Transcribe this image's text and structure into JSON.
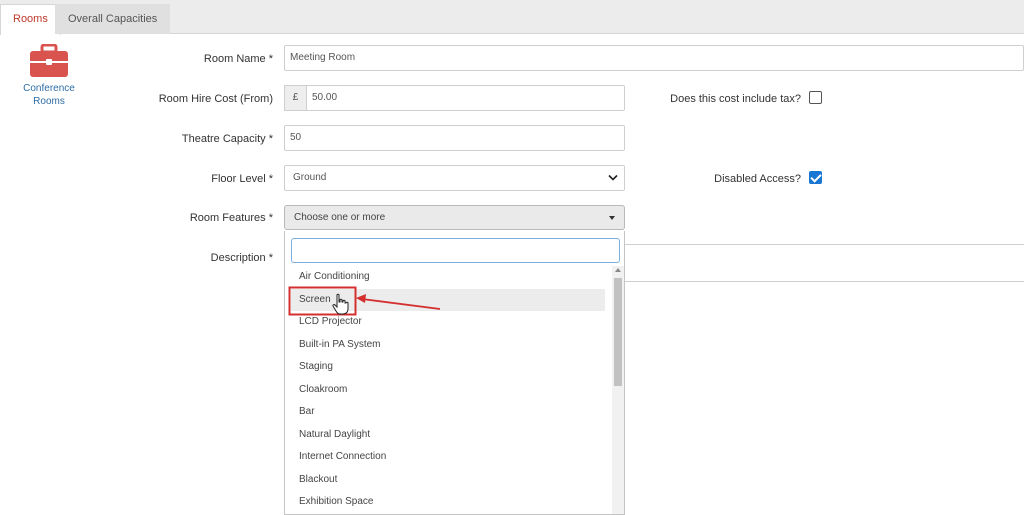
{
  "tabs": [
    {
      "label": "Rooms",
      "active": true
    },
    {
      "label": "Overall Capacities",
      "active": false
    }
  ],
  "side": {
    "icon": "briefcase-icon",
    "icon_color": "#d9534f",
    "label_line1": "Conference",
    "label_line2": "Rooms"
  },
  "form": {
    "room_name": {
      "label": "Room Name *",
      "value": "Meeting Room"
    },
    "hire_cost": {
      "label": "Room Hire Cost (From)",
      "currency": "£",
      "value": "50.00"
    },
    "tax": {
      "label": "Does this cost include tax?",
      "checked": false
    },
    "theatre_capacity": {
      "label": "Theatre Capacity *",
      "value": "50"
    },
    "floor_level": {
      "label": "Floor Level *",
      "value": "Ground"
    },
    "disabled_access": {
      "label": "Disabled Access?",
      "checked": true
    },
    "room_features": {
      "label": "Room Features *",
      "placeholder": "Choose one or more"
    },
    "description": {
      "label": "Description *"
    }
  },
  "dropdown": {
    "search_value": "",
    "highlighted": "Screen",
    "options": [
      "Air Conditioning",
      "Screen",
      "LCD Projector",
      "Built-in PA System",
      "Staging",
      "Cloakroom",
      "Bar",
      "Natural Daylight",
      "Internet Connection",
      "Blackout",
      "Exhibition Space"
    ]
  },
  "colors": {
    "active_tab": "#c0392b",
    "checkbox_checked": "#1976d2",
    "annotation": "#d32f2f"
  }
}
